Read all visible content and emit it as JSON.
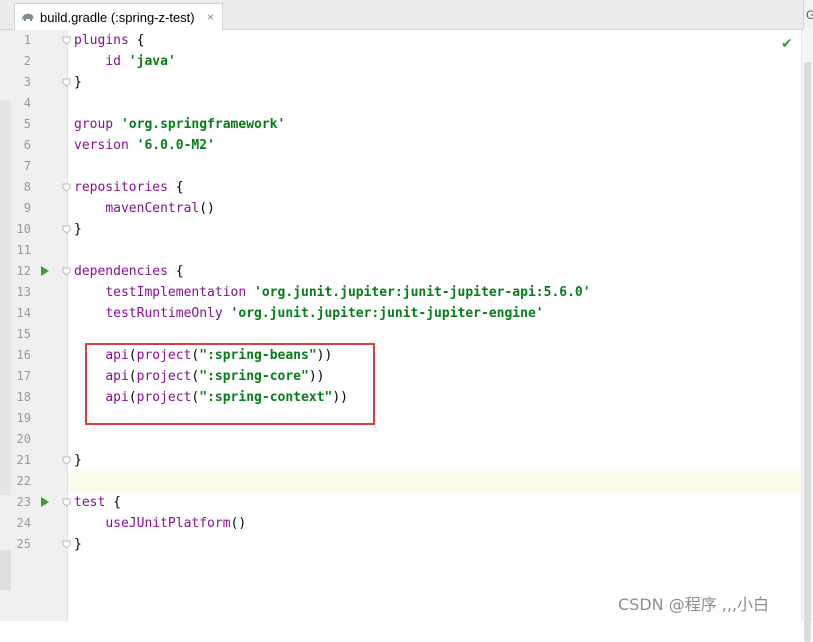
{
  "tab": {
    "title": "build.gradle (:spring-z-test)",
    "close": "×"
  },
  "right_tab_letter": "G",
  "watermark": "CSDN @程序  ,,,小白",
  "colors": {
    "keyword": "#871094",
    "string": "#067d17",
    "run": "#3c9d3c",
    "highlight": "#e03c3c",
    "current_line": "#fcfae9"
  },
  "lines": [
    {
      "n": "1",
      "parts": [
        [
          "kw",
          "plugins"
        ],
        [
          "plain",
          " {"
        ]
      ]
    },
    {
      "n": "2",
      "parts": [
        [
          "plain",
          "    "
        ],
        [
          "kw",
          "id"
        ],
        [
          "plain",
          " "
        ],
        [
          "str",
          "'java'"
        ]
      ]
    },
    {
      "n": "3",
      "parts": [
        [
          "plain",
          "}"
        ]
      ]
    },
    {
      "n": "4",
      "parts": []
    },
    {
      "n": "5",
      "parts": [
        [
          "kw",
          "group"
        ],
        [
          "plain",
          " "
        ],
        [
          "str",
          "'org.springframework'"
        ]
      ]
    },
    {
      "n": "6",
      "parts": [
        [
          "kw",
          "version"
        ],
        [
          "plain",
          " "
        ],
        [
          "str",
          "'6.0.0-M2'"
        ]
      ]
    },
    {
      "n": "7",
      "parts": []
    },
    {
      "n": "8",
      "parts": [
        [
          "kw",
          "repositories"
        ],
        [
          "plain",
          " {"
        ]
      ]
    },
    {
      "n": "9",
      "parts": [
        [
          "plain",
          "    "
        ],
        [
          "kw",
          "mavenCentral"
        ],
        [
          "plain",
          "()"
        ]
      ]
    },
    {
      "n": "10",
      "parts": [
        [
          "plain",
          "}"
        ]
      ]
    },
    {
      "n": "11",
      "parts": []
    },
    {
      "n": "12",
      "parts": [
        [
          "kw",
          "dependencies"
        ],
        [
          "plain",
          " {"
        ]
      ]
    },
    {
      "n": "13",
      "parts": [
        [
          "plain",
          "    "
        ],
        [
          "kw",
          "testImplementation"
        ],
        [
          "plain",
          " "
        ],
        [
          "str",
          "'org.junit.jupiter:junit-jupiter-api:5.6.0'"
        ]
      ]
    },
    {
      "n": "14",
      "parts": [
        [
          "plain",
          "    "
        ],
        [
          "kw",
          "testRuntimeOnly"
        ],
        [
          "plain",
          " "
        ],
        [
          "str",
          "'org.junit.jupiter:junit-jupiter-engine'"
        ]
      ]
    },
    {
      "n": "15",
      "parts": []
    },
    {
      "n": "16",
      "parts": [
        [
          "plain",
          "    "
        ],
        [
          "kw",
          "api"
        ],
        [
          "plain",
          "("
        ],
        [
          "kw",
          "project"
        ],
        [
          "plain",
          "("
        ],
        [
          "str",
          "\":spring-beans\""
        ],
        [
          "plain",
          "))"
        ]
      ]
    },
    {
      "n": "17",
      "parts": [
        [
          "plain",
          "    "
        ],
        [
          "kw",
          "api"
        ],
        [
          "plain",
          "("
        ],
        [
          "kw",
          "project"
        ],
        [
          "plain",
          "("
        ],
        [
          "str",
          "\":spring-core\""
        ],
        [
          "plain",
          "))"
        ]
      ]
    },
    {
      "n": "18",
      "parts": [
        [
          "plain",
          "    "
        ],
        [
          "kw",
          "api"
        ],
        [
          "plain",
          "("
        ],
        [
          "kw",
          "project"
        ],
        [
          "plain",
          "("
        ],
        [
          "str",
          "\":spring-context\""
        ],
        [
          "plain",
          "))"
        ]
      ]
    },
    {
      "n": "19",
      "parts": []
    },
    {
      "n": "20",
      "parts": []
    },
    {
      "n": "21",
      "parts": [
        [
          "plain",
          "}"
        ]
      ]
    },
    {
      "n": "22",
      "parts": []
    },
    {
      "n": "23",
      "parts": [
        [
          "kw",
          "test"
        ],
        [
          "plain",
          " {"
        ]
      ]
    },
    {
      "n": "24",
      "parts": [
        [
          "plain",
          "    "
        ],
        [
          "kw",
          "useJUnitPlatform"
        ],
        [
          "plain",
          "()"
        ]
      ]
    },
    {
      "n": "25",
      "parts": [
        [
          "plain",
          "}"
        ]
      ]
    }
  ],
  "run_lines": [
    "12",
    "23"
  ],
  "fold_lines": [
    "1",
    "3",
    "8",
    "10",
    "12",
    "21",
    "23",
    "25"
  ],
  "current_line": "22"
}
